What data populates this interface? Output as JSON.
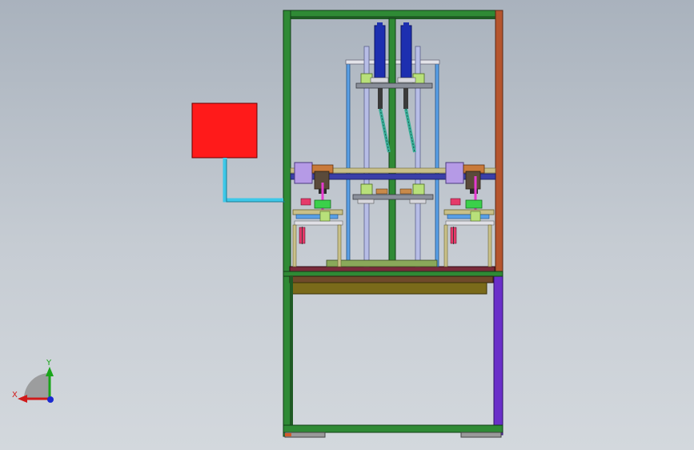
{
  "colors": {
    "frame_green": "#2f8a35",
    "frame_dark": "#1f5a24",
    "frame_orange": "#b5552e",
    "frame_purple": "#6a2fc9",
    "controller_red": "#ff1a1a",
    "cable_cyan": "#3ec8e8",
    "cylinder_blue": "#1d2fb0",
    "rail_blue": "#5aa0e6",
    "shaft_lavender": "#b7bde6",
    "plate_brown": "#6f4a2a",
    "plate_olive": "#7a6a1a",
    "clamp_lavender": "#b59ae6",
    "spring_magenta": "#e63ad0",
    "ring_lightgreen": "#b8e07a"
  },
  "icons": {
    "triad": "coordinate-triad-icon"
  },
  "triad": {
    "x_label": "X",
    "y_label": "Y"
  }
}
